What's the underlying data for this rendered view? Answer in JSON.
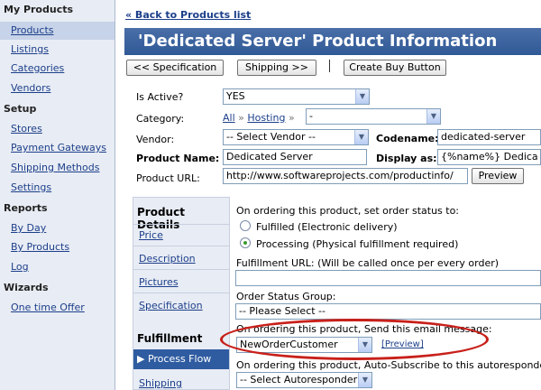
{
  "nav": {
    "sections": [
      {
        "heading": "My Products",
        "items": [
          "Products",
          "Listings",
          "Categories",
          "Vendors"
        ]
      },
      {
        "heading": "Setup",
        "items": [
          "Stores",
          "Payment Gateways",
          "Shipping Methods",
          "Settings"
        ]
      },
      {
        "heading": "Reports",
        "items": [
          "By Day",
          "By Products",
          "Log"
        ]
      },
      {
        "heading": "Wizards",
        "items": [
          "One time Offer"
        ]
      }
    ]
  },
  "header": {
    "back_link": "« Back to Products list",
    "title": "'Dedicated Server' Product Information"
  },
  "toolbar": {
    "prev_label": "<< Specification",
    "next_label": "Shipping >>",
    "create_buy_label": "Create Buy Button"
  },
  "form": {
    "is_active": {
      "label": "Is Active?",
      "value": "YES"
    },
    "category": {
      "label": "Category:",
      "crumb_all": "All",
      "sep": "»",
      "crumb_hosting": "Hosting",
      "value": "-"
    },
    "vendor": {
      "label": "Vendor:",
      "value": "-- Select Vendor --"
    },
    "codename": {
      "label": "Codename:",
      "value": "dedicated-server"
    },
    "product_name": {
      "label": "Product Name:",
      "value": "Dedicated Server"
    },
    "display_as": {
      "label": "Display as:",
      "value": "{%name%} Dedica"
    },
    "product_url": {
      "label": "Product URL:",
      "value": "http://www.softwareprojects.com/productinfo/",
      "preview": "Preview"
    }
  },
  "tabs": {
    "product_details": {
      "heading": "Product Details",
      "links": [
        "Price",
        "Description",
        "Pictures",
        "Specification"
      ]
    },
    "fulfillment": {
      "heading": "Fulfillment",
      "active": "▶ Process Flow",
      "next": "Shipping"
    }
  },
  "fulfillment": {
    "order_status_prompt": "On ordering this product, set order status to:",
    "radio_fulfilled": "Fulfilled (Electronic delivery)",
    "radio_processing": "Processing (Physical fulfillment required)",
    "fulfillment_url_label": "Fulfillment URL: (Will be called once per every order)",
    "fulfillment_url_value": "",
    "order_status_group_label": "Order Status Group:",
    "order_status_group_value": "-- Please Select --",
    "email_prompt": "On ordering this product, Send this email message:",
    "email_value": "NewOrderCustomer",
    "email_preview": "[Preview]",
    "autoresponder_prompt": "On ordering this product, Auto-Subscribe to this autoresponder:",
    "autoresponder_value": "-- Select Autoresponder --"
  },
  "colors": {
    "title_bar": "#305a96",
    "highlight": "#c8201a",
    "nav_bg": "#e8ecf4",
    "active_tab": "#2f5ca1"
  }
}
